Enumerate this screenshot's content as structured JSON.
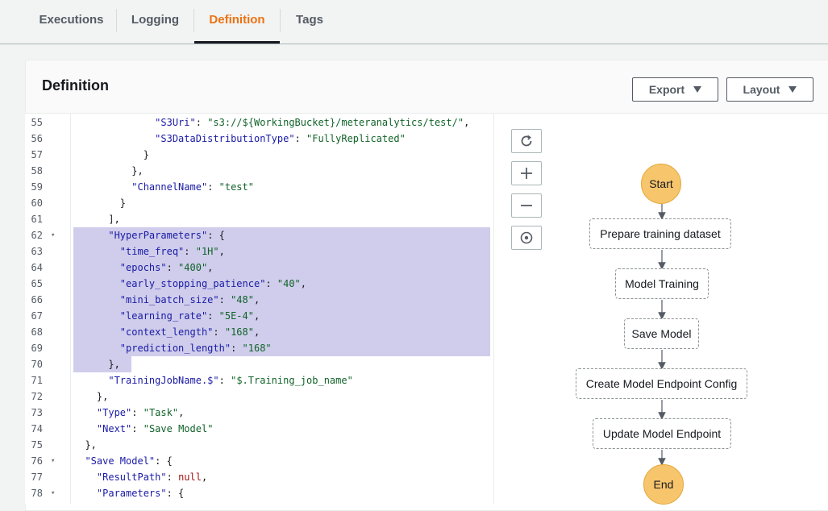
{
  "tabs": [
    "Executions",
    "Logging",
    "Definition",
    "Tags"
  ],
  "panel": {
    "title": "Definition",
    "export_label": "Export",
    "layout_label": "Layout"
  },
  "editor": {
    "line_numbers": [
      "55",
      "56",
      "57",
      "58",
      "59",
      "60",
      "61",
      "62",
      "63",
      "64",
      "65",
      "66",
      "67",
      "68",
      "69",
      "70",
      "71",
      "72",
      "73",
      "74",
      "75",
      "76",
      "77",
      "78"
    ],
    "selected_lines": [
      "62",
      "63",
      "64",
      "65",
      "66",
      "67",
      "68",
      "69",
      "70"
    ],
    "lines": [
      {
        "indent": "              ",
        "tokens": [
          [
            "k",
            "\"S3Uri\""
          ],
          [
            "p",
            ": "
          ],
          [
            "s",
            "\"s3://${WorkingBucket}/meteranalytics/test/\""
          ],
          [
            "p",
            ","
          ]
        ]
      },
      {
        "indent": "              ",
        "tokens": [
          [
            "k",
            "\"S3DataDistributionType\""
          ],
          [
            "p",
            ": "
          ],
          [
            "s",
            "\"FullyReplicated\""
          ]
        ]
      },
      {
        "indent": "            ",
        "tokens": [
          [
            "p",
            "}"
          ]
        ]
      },
      {
        "indent": "          ",
        "tokens": [
          [
            "p",
            "},"
          ]
        ]
      },
      {
        "indent": "          ",
        "tokens": [
          [
            "k",
            "\"ChannelName\""
          ],
          [
            "p",
            ": "
          ],
          [
            "s",
            "\"test\""
          ]
        ]
      },
      {
        "indent": "        ",
        "tokens": [
          [
            "p",
            "}"
          ]
        ]
      },
      {
        "indent": "      ",
        "tokens": [
          [
            "p",
            "],"
          ]
        ]
      },
      {
        "indent": "      ",
        "tokens": [
          [
            "k",
            "\"HyperParameters\""
          ],
          [
            "p",
            ": {"
          ]
        ]
      },
      {
        "indent": "        ",
        "tokens": [
          [
            "k",
            "\"time_freq\""
          ],
          [
            "p",
            ": "
          ],
          [
            "s",
            "\"1H\""
          ],
          [
            "p",
            ","
          ]
        ]
      },
      {
        "indent": "        ",
        "tokens": [
          [
            "k",
            "\"epochs\""
          ],
          [
            "p",
            ": "
          ],
          [
            "s",
            "\"400\""
          ],
          [
            "p",
            ","
          ]
        ]
      },
      {
        "indent": "        ",
        "tokens": [
          [
            "k",
            "\"early_stopping_patience\""
          ],
          [
            "p",
            ": "
          ],
          [
            "s",
            "\"40\""
          ],
          [
            "p",
            ","
          ]
        ]
      },
      {
        "indent": "        ",
        "tokens": [
          [
            "k",
            "\"mini_batch_size\""
          ],
          [
            "p",
            ": "
          ],
          [
            "s",
            "\"48\""
          ],
          [
            "p",
            ","
          ]
        ]
      },
      {
        "indent": "        ",
        "tokens": [
          [
            "k",
            "\"learning_rate\""
          ],
          [
            "p",
            ": "
          ],
          [
            "s",
            "\"5E-4\""
          ],
          [
            "p",
            ","
          ]
        ]
      },
      {
        "indent": "        ",
        "tokens": [
          [
            "k",
            "\"context_length\""
          ],
          [
            "p",
            ": "
          ],
          [
            "s",
            "\"168\""
          ],
          [
            "p",
            ","
          ]
        ]
      },
      {
        "indent": "        ",
        "tokens": [
          [
            "k",
            "\"prediction_length\""
          ],
          [
            "p",
            ": "
          ],
          [
            "s",
            "\"168\""
          ]
        ]
      },
      {
        "indent": "      ",
        "tokens": [
          [
            "p",
            "},"
          ]
        ]
      },
      {
        "indent": "      ",
        "tokens": [
          [
            "k",
            "\"TrainingJobName.$\""
          ],
          [
            "p",
            ": "
          ],
          [
            "s",
            "\"$.Training_job_name\""
          ]
        ]
      },
      {
        "indent": "    ",
        "tokens": [
          [
            "p",
            "},"
          ]
        ]
      },
      {
        "indent": "    ",
        "tokens": [
          [
            "k",
            "\"Type\""
          ],
          [
            "p",
            ": "
          ],
          [
            "s",
            "\"Task\""
          ],
          [
            "p",
            ","
          ]
        ]
      },
      {
        "indent": "    ",
        "tokens": [
          [
            "k",
            "\"Next\""
          ],
          [
            "p",
            ": "
          ],
          [
            "s",
            "\"Save Model\""
          ]
        ]
      },
      {
        "indent": "  ",
        "tokens": [
          [
            "p",
            "},"
          ]
        ]
      },
      {
        "indent": "  ",
        "tokens": [
          [
            "k",
            "\"Save Model\""
          ],
          [
            "p",
            ": {"
          ]
        ]
      },
      {
        "indent": "    ",
        "tokens": [
          [
            "k",
            "\"ResultPath\""
          ],
          [
            "p",
            ": "
          ],
          [
            "n",
            "null"
          ],
          [
            "p",
            ","
          ]
        ]
      },
      {
        "indent": "    ",
        "tokens": [
          [
            "k",
            "\"Parameters\""
          ],
          [
            "p",
            ": {"
          ]
        ]
      }
    ],
    "fold_lines": [
      "62",
      "76",
      "78"
    ]
  },
  "graph": {
    "controls": [
      "refresh-icon",
      "zoom-in-icon",
      "zoom-out-icon",
      "center-icon"
    ],
    "start_label": "Start",
    "end_label": "End",
    "steps": [
      "Prepare training dataset",
      "Model Training",
      "Save Model",
      "Create Model Endpoint Config",
      "Update Model Endpoint"
    ]
  },
  "colors": {
    "active_tab": "#ec7211",
    "selection": "#cfcdeb",
    "terminal_node": "#f7c56c"
  }
}
